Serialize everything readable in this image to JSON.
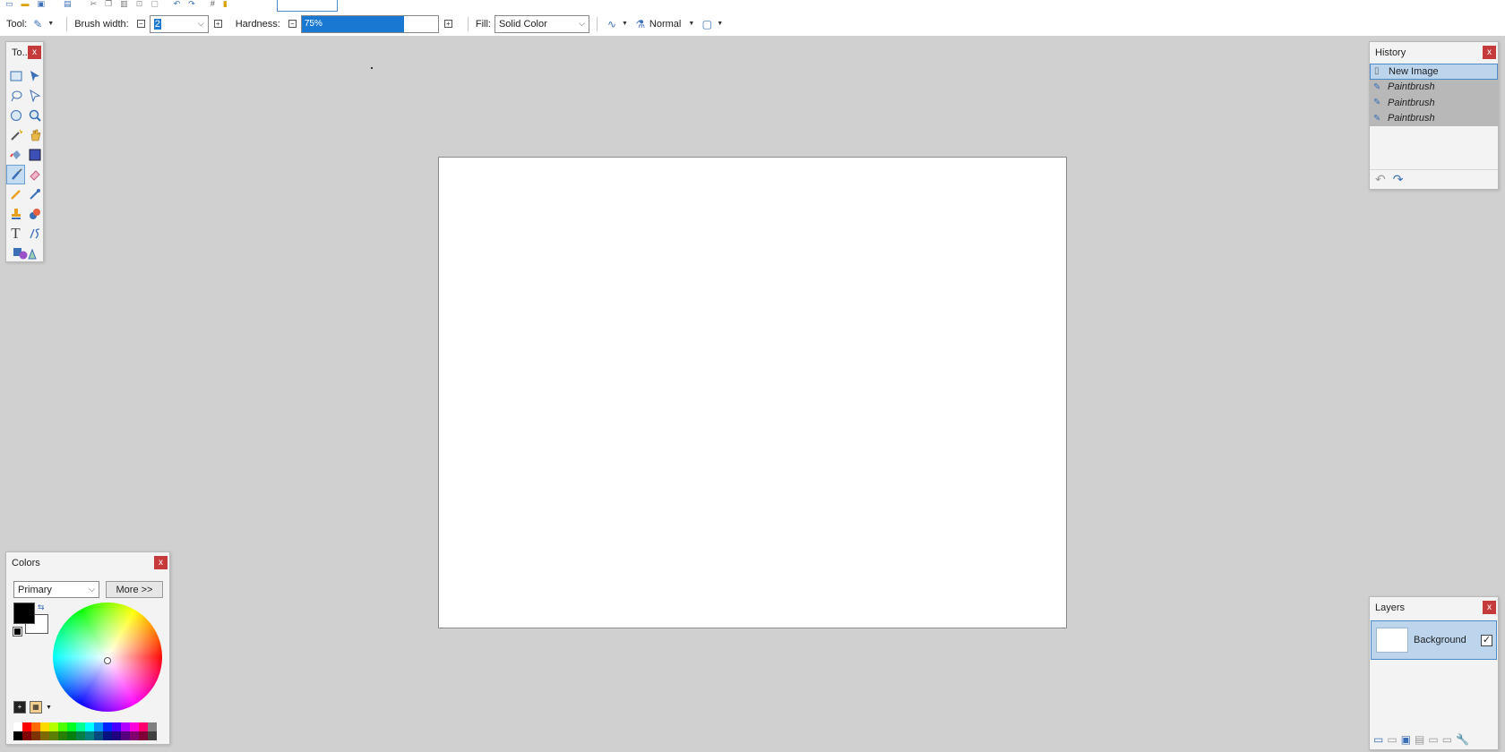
{
  "toolbar": {
    "tool_label": "Tool:",
    "brush_width_label": "Brush width:",
    "brush_width_value": "2",
    "hardness_label": "Hardness:",
    "hardness_value": "75%",
    "hardness_percent": 75,
    "fill_label": "Fill:",
    "fill_value": "Solid Color",
    "blend_mode": "Normal"
  },
  "tools_panel": {
    "title": "To...",
    "close": "x",
    "tools": [
      "rectangle-select-icon",
      "move-selected-icon",
      "lasso-select-icon",
      "move-selection-icon",
      "ellipse-select-icon",
      "zoom-icon",
      "magic-wand-icon",
      "pan-icon",
      "paint-bucket-icon",
      "gradient-icon",
      "paintbrush-icon",
      "eraser-icon",
      "pencil-icon",
      "color-picker-icon",
      "clone-stamp-icon",
      "recolor-icon",
      "text-icon",
      "line-curve-icon",
      "shapes-icon"
    ],
    "selected": "paintbrush-icon"
  },
  "history": {
    "title": "History",
    "close": "x",
    "items": [
      {
        "label": "New Image",
        "state": "current"
      },
      {
        "label": "Paintbrush",
        "state": "redo"
      },
      {
        "label": "Paintbrush",
        "state": "redo"
      },
      {
        "label": "Paintbrush",
        "state": "redo"
      }
    ]
  },
  "layers": {
    "title": "Layers",
    "close": "x",
    "items": [
      {
        "name": "Background",
        "visible": true
      }
    ]
  },
  "colors": {
    "title": "Colors",
    "close": "x",
    "mode": "Primary",
    "more_label": "More >>",
    "primary": "#000000",
    "secondary": "#ffffff",
    "palette": [
      "#ffffff",
      "#ff0000",
      "#ff6a00",
      "#ffd800",
      "#b6ff00",
      "#4cff00",
      "#00ff21",
      "#00ff90",
      "#00ffff",
      "#0094ff",
      "#0026ff",
      "#4800ff",
      "#b200ff",
      "#ff00dc",
      "#ff006e",
      "#808080",
      "#000000",
      "#7f0000",
      "#7f3300",
      "#7f6a00",
      "#5b7f00",
      "#267f00",
      "#007f0e",
      "#007f46",
      "#007f7f",
      "#004a7f",
      "#00137f",
      "#21007f",
      "#57007f",
      "#7f006e",
      "#7f0037",
      "#404040"
    ]
  },
  "accent": "#1979d2"
}
